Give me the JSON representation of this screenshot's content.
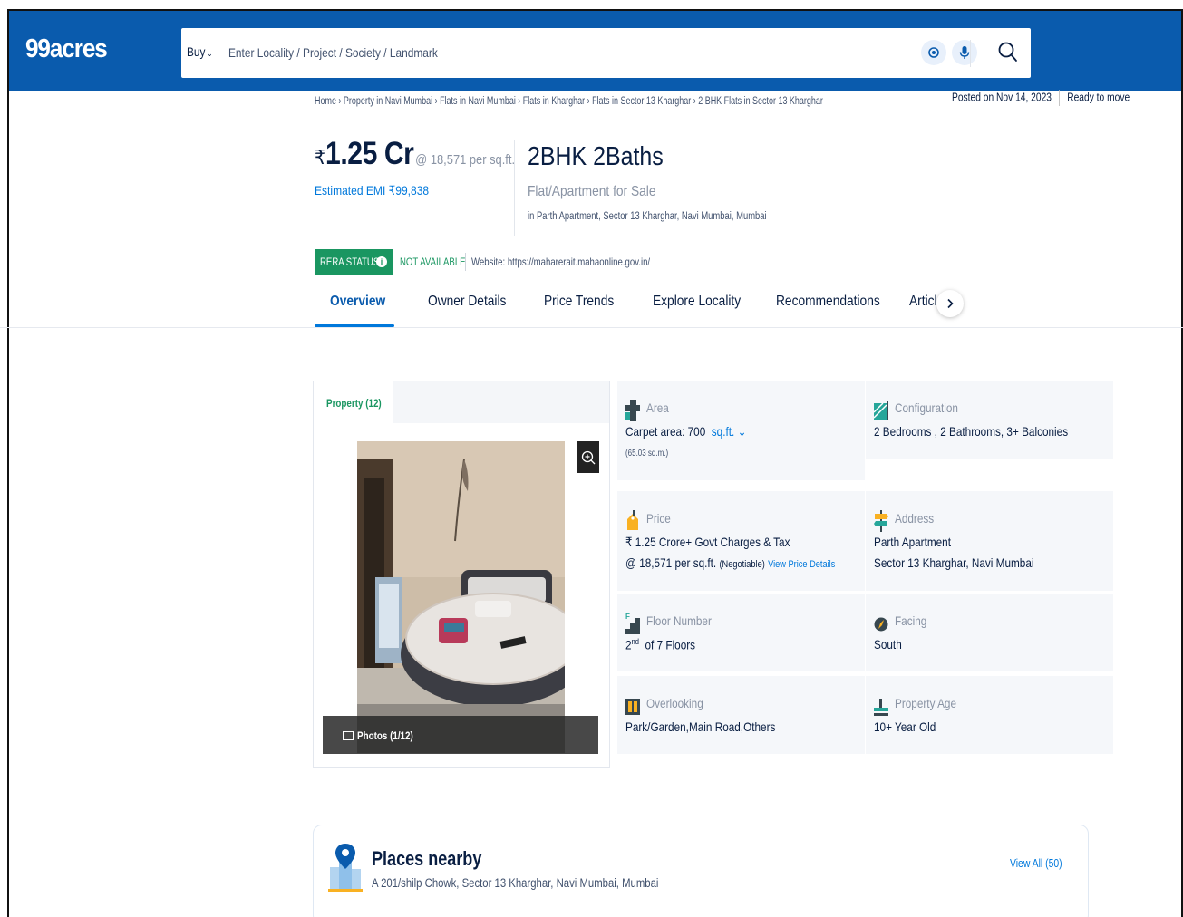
{
  "header": {
    "logo": "99acres",
    "buy_label": "Buy",
    "search_placeholder": "Enter Locality / Project / Society / Landmark"
  },
  "breadcrumb": "Home › Property in Navi Mumbai › Flats in Navi Mumbai › Flats in Kharghar › Flats in Sector 13 Kharghar › 2 BHK Flats in Sector 13 Kharghar",
  "posted": {
    "date": "Posted on Nov 14, 2023",
    "status": "Ready to move"
  },
  "listing": {
    "currency": "₹",
    "price": "1.25 Cr",
    "per_sqft": "@ 18,571 per sq.ft.",
    "emi": "Estimated EMI ₹99,838",
    "configuration": "2BHK 2Baths",
    "type": "Flat/Apartment for Sale",
    "location": "in Parth Apartment, Sector 13 Kharghar, Navi Mumbai, Mumbai"
  },
  "rera": {
    "status_label": "RERA STATUS",
    "value": "NOT AVAILABLE",
    "website": "Website: https://maharerait.mahaonline.gov.in/"
  },
  "tabs": [
    {
      "label": "Overview"
    },
    {
      "label": "Owner Details"
    },
    {
      "label": "Price Trends"
    },
    {
      "label": "Explore Locality"
    },
    {
      "label": "Recommendations"
    },
    {
      "label": "Articl"
    }
  ],
  "gallery": {
    "tab_label": "Property (12)",
    "photos_label": "Photos (1/12)"
  },
  "details": {
    "area": {
      "label": "Area",
      "value": "Carpet area: 700",
      "unit": "sq.ft.",
      "sub": "(65.03 sq.m.)"
    },
    "configuration": {
      "label": "Configuration",
      "value": "2 Bedrooms , 2 Bathrooms, 3+ Balconies"
    },
    "price": {
      "label": "Price",
      "line1": "₹ 1.25 Crore+ Govt Charges & Tax",
      "line2": "@ 18,571 per sq.ft.",
      "negotiable": "(Negotiable)",
      "link": "View Price Details"
    },
    "address": {
      "label": "Address",
      "line1": "Parth Apartment",
      "line2": "Sector 13 Kharghar, Navi Mumbai"
    },
    "floor": {
      "label": "Floor Number",
      "value": "2",
      "suffix": "nd",
      "rest": "of 7 Floors"
    },
    "facing": {
      "label": "Facing",
      "value": "South"
    },
    "overlooking": {
      "label": "Overlooking",
      "value": "Park/Garden,Main Road,Others"
    },
    "age": {
      "label": "Property Age",
      "value": "10+ Year Old"
    }
  },
  "places": {
    "title": "Places nearby",
    "address": "A 201/shilp Chowk, Sector 13 Kharghar, Navi Mumbai, Mumbai",
    "view_all": "View All (50)"
  },
  "colors": {
    "header_bg": "#0a5bad",
    "accent_blue": "#0078db",
    "rera_green": "#1a9661"
  }
}
